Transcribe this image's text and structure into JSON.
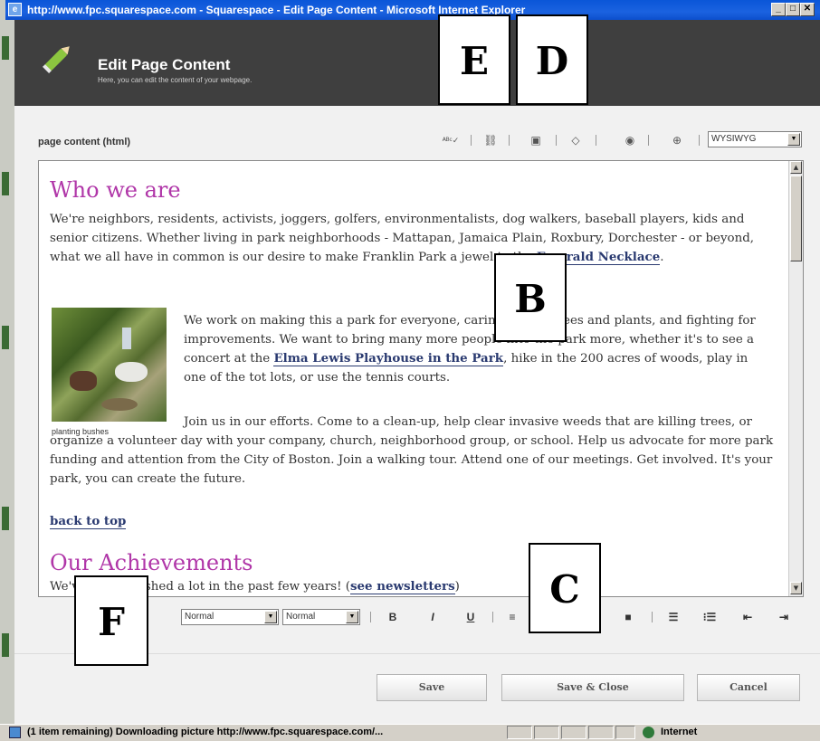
{
  "window": {
    "title": "http://www.fpc.squarespace.com - Squarespace - Edit Page Content - Microsoft Internet Explorer",
    "min": "_",
    "max": "□",
    "close": "✕"
  },
  "header": {
    "title": "Edit Page Content",
    "subtitle": "Here, you can edit the content of your webpage."
  },
  "editor_toolbar": {
    "label": "page content (html)",
    "tools": [
      {
        "icon": "spellcheck-icon",
        "glyph": "ᴬᴮᶜ✓"
      },
      {
        "icon": "link-icon",
        "glyph": "⛓"
      },
      {
        "icon": "image-icon",
        "glyph": "▣"
      },
      {
        "icon": "code-icon",
        "glyph": "◇"
      },
      {
        "icon": "help-icon",
        "glyph": "◉"
      },
      {
        "icon": "zoom-icon",
        "glyph": "⊕"
      }
    ],
    "mode": "WYSIWYG"
  },
  "content": {
    "heading1": "Who we are",
    "para1_text": "We're neighbors, residents, activists, joggers, golfers, environmentalists, dog walkers, baseball players, kids and senior citizens.  Whether living in park neighborhoods - Mattapan, Jamaica Plain, Roxbury, Dorchester - or beyond, what we all have in common is our desire to make Franklin Park a jewel in the",
    "para1_link": "Emerald Necklace",
    "para1_end": ".",
    "para2_a": "We work on making this a park for everyone, caring for the trees and plants, and fighting for improvements. We want to bring many more people into the park more, whether it's to see a concert at the",
    "para2_link": "Elma Lewis Playhouse in the Park",
    "para2_b": ", hike in the 200 acres of woods,  play in one of the tot lots, or use the tennis courts.",
    "photo_caption": "planting bushes",
    "para3": "Join us in our efforts.  Come to a clean-up, help clear invasive weeds that are killing trees, or organize a volunteer day with your company, church, neighborhood group, or school.  Help us advocate for more park funding and attention from the City of Boston.  Join a walking tour. Attend one of our meetings.  Get involved.  It's your park, you can create the future.",
    "back_to_top": "back to top",
    "heading2": "Our Achievements",
    "para4_text": "We've accomplished a lot in the past few years!  (",
    "para4_link": "see newsletters",
    "para4_end": ")"
  },
  "format_bar": {
    "style_select": "Normal",
    "size_select": "Normal",
    "bold": "B",
    "italic": "I",
    "underline": "U",
    "align_left": "≡",
    "align_justify": "■",
    "bullet_list": "☰",
    "numbered_list": "⁝☰",
    "outdent": "⇤",
    "indent": "⇥"
  },
  "buttons": {
    "save": "Save",
    "save_close": "Save & Close",
    "cancel": "Cancel"
  },
  "statusbar": {
    "text": "(1 item remaining) Downloading picture http://www.fpc.squarespace.com/...",
    "zone": "Internet"
  },
  "overlay_labels": {
    "B": "B",
    "C": "C",
    "D": "D",
    "E": "E",
    "F": "F"
  },
  "colors": {
    "heading": "#b036a8",
    "link": "#2a3a70",
    "header_bg": "#3f3f3f",
    "titlebar": "#0a56d8"
  }
}
